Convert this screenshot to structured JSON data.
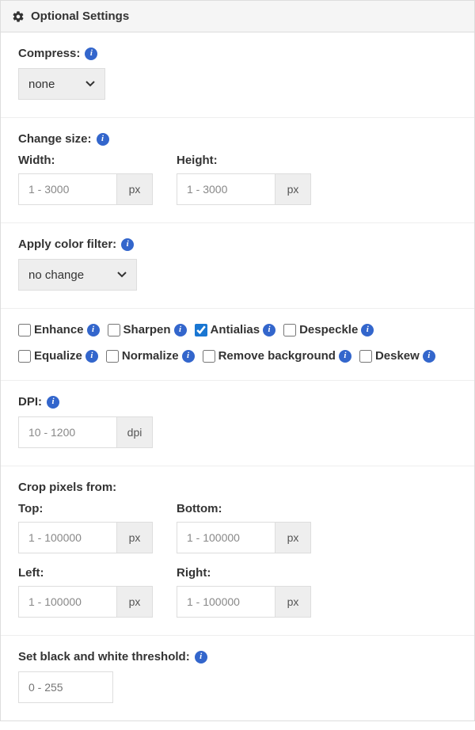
{
  "header": {
    "title": "Optional Settings"
  },
  "compress": {
    "label": "Compress:",
    "selected": "none"
  },
  "size": {
    "label": "Change size:",
    "width_label": "Width:",
    "height_label": "Height:",
    "placeholder": "1 - 3000",
    "unit": "px"
  },
  "colorfilter": {
    "label": "Apply color filter:",
    "selected": "no change"
  },
  "checks": {
    "enhance": "Enhance",
    "sharpen": "Sharpen",
    "antialias": "Antialias",
    "despeckle": "Despeckle",
    "equalize": "Equalize",
    "normalize": "Normalize",
    "removebg": "Remove background",
    "deskew": "Deskew"
  },
  "dpi": {
    "label": "DPI:",
    "placeholder": "10 - 1200",
    "unit": "dpi"
  },
  "crop": {
    "label": "Crop pixels from:",
    "top": "Top:",
    "bottom": "Bottom:",
    "left": "Left:",
    "right": "Right:",
    "placeholder": "1 - 100000",
    "unit": "px"
  },
  "threshold": {
    "label": "Set black and white threshold:",
    "placeholder": "0 - 255"
  },
  "info_glyph": "i"
}
